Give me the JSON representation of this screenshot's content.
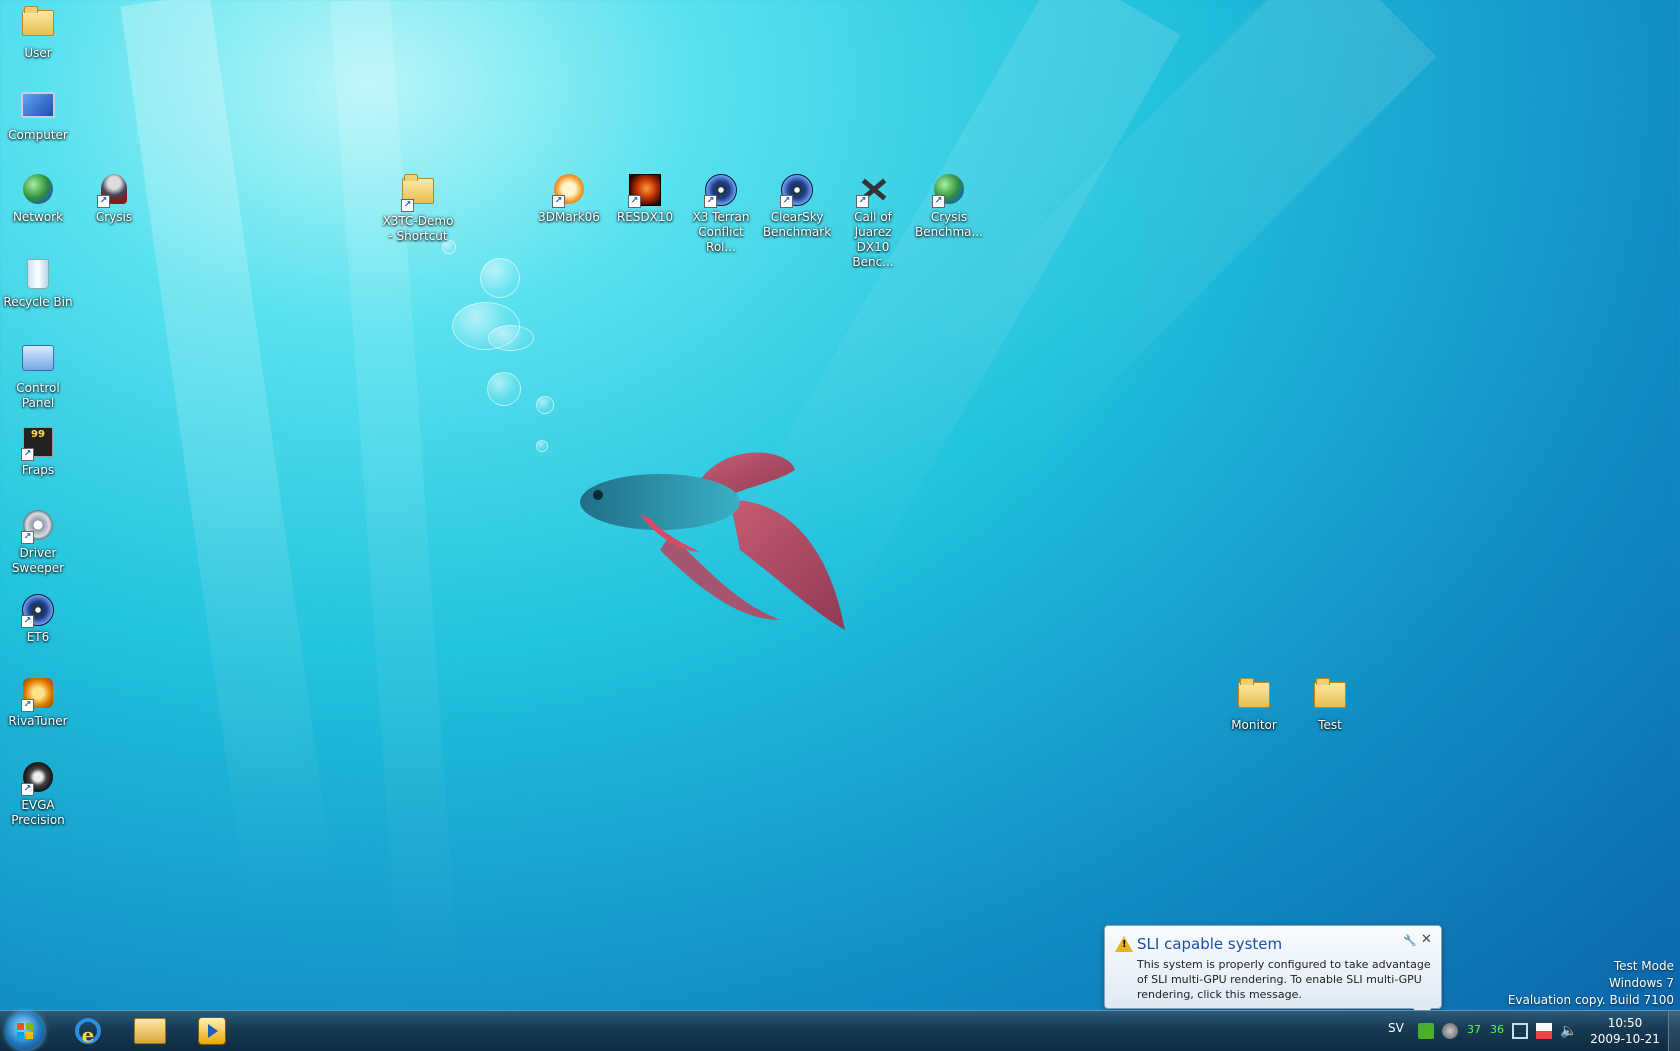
{
  "desktop_icons": {
    "user": "User",
    "computer": "Computer",
    "network": "Network",
    "crysis": "Crysis",
    "recycle_bin": "Recycle Bin",
    "control_panel": "Control Panel",
    "fraps": "Fraps",
    "driver_sweeper": "Driver\nSweeper",
    "et6": "ET6",
    "rivatuner": "RivaTuner",
    "evga_precision": "EVGA\nPrecision",
    "x3tc_demo": "X3TC-Demo\n- Shortcut",
    "3dmark06": "3DMark06",
    "resdx10": "RESDX10",
    "x3_terran": "X3 Terran\nConflict Rol...",
    "clearsky": "ClearSky\nBenchmark",
    "call_of_juarez": "Call of Juarez\nDX10 Benc...",
    "crysis_benchmark": "Crysis\nBenchma...",
    "monitor": "Monitor",
    "test": "Test"
  },
  "fraps_icon_text": "99",
  "watermark": {
    "line1": "Test Mode",
    "line2": "Windows 7",
    "line3": "Evaluation copy. Build 7100"
  },
  "notification": {
    "title": "SLI capable system",
    "message": "This system is properly configured to take advantage of SLI multi-GPU rendering. To enable SLI multi-GPU rendering, click this message.",
    "warning_symbol": "!",
    "options_symbol": "🔧",
    "close_symbol": "✕"
  },
  "taskbar": {
    "language": "SV",
    "tray_temp1": "37",
    "tray_temp2": "36",
    "time": "10:50",
    "date": "2009-10-21",
    "ie_glyph": "e"
  },
  "colors": {
    "start_red": "#f25022",
    "start_green": "#7fba00",
    "start_blue": "#00a4ef",
    "start_yellow": "#ffb900"
  }
}
